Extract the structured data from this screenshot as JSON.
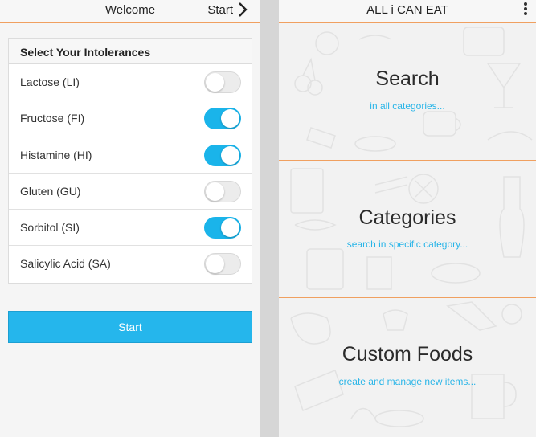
{
  "left": {
    "header": {
      "title": "Welcome",
      "start_label": "Start"
    },
    "intolerances": {
      "heading": "Select Your Intolerances",
      "items": [
        {
          "label": "Lactose (LI)",
          "enabled": false
        },
        {
          "label": "Fructose (FI)",
          "enabled": true
        },
        {
          "label": "Histamine (HI)",
          "enabled": true
        },
        {
          "label": "Gluten (GU)",
          "enabled": false
        },
        {
          "label": "Sorbitol (SI)",
          "enabled": true
        },
        {
          "label": "Salicylic Acid (SA)",
          "enabled": false
        }
      ]
    },
    "start_button": "Start"
  },
  "right": {
    "header": {
      "title": "ALL i CAN EAT"
    },
    "sections": [
      {
        "title": "Search",
        "subtitle": "in all categories..."
      },
      {
        "title": "Categories",
        "subtitle": "search in specific category..."
      },
      {
        "title": "Custom Foods",
        "subtitle": "create and manage new items..."
      }
    ]
  },
  "colors": {
    "accent": "#1ab4ea",
    "divider": "#f0a060"
  }
}
